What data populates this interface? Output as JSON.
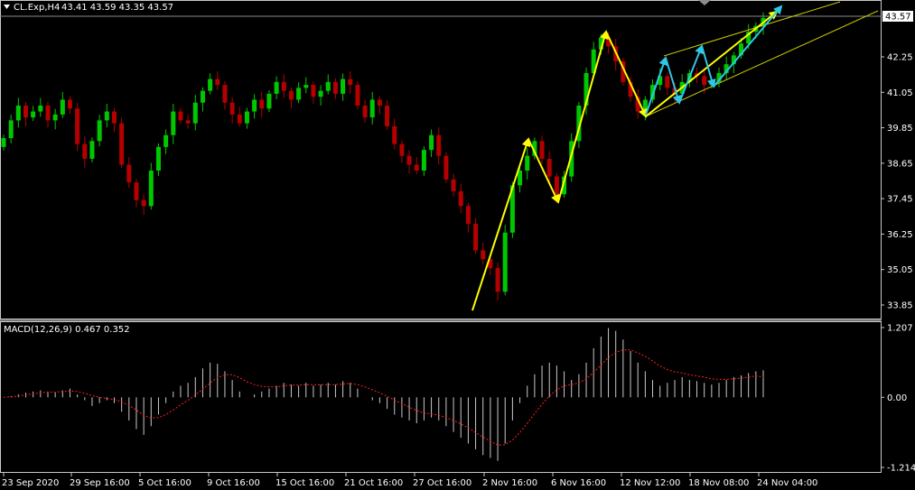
{
  "header": {
    "symbol_label": "CL.Exp,H4",
    "ohlc_label": "43.41 43.59 43.35 43.57"
  },
  "macd": {
    "label": "MACD(12,26,9) 0.467 0.352"
  },
  "colors": {
    "background": "#000000",
    "bull_candle": "#00c800",
    "bear_candle": "#b40000",
    "frame": "#c8c8c8",
    "bid_line": "#8c8c8c",
    "price_tag_bg": "#ffffff",
    "wave_yellow": "#ffff00",
    "wave_cyan": "#2ec8e6",
    "channel": "#c8c800",
    "macd_hist": "#c8c8c8",
    "macd_signal": "#ff2020"
  },
  "chart_data": [
    {
      "type": "candlestick",
      "title": "CL.Exp,H4",
      "current_price": "43.57",
      "y_ticks": [
        "42.25",
        "41.05",
        "39.85",
        "38.65",
        "37.45",
        "36.25",
        "35.05",
        "33.85"
      ],
      "ylim": [
        33.5,
        43.8
      ],
      "x_ticks": [
        "23 Sep 2020",
        "29 Sep 16:00",
        "5 Oct 16:00",
        "9 Oct 16:00",
        "15 Oct 16:00",
        "21 Oct 16:00",
        "27 Oct 16:00",
        "2 Nov 16:00",
        "6 Nov 16:00",
        "12 Nov 12:00",
        "18 Nov 08:00",
        "24 Nov 04:00"
      ],
      "closes": [
        39.5,
        40.1,
        40.6,
        40.2,
        40.4,
        40.6,
        40.1,
        40.3,
        40.8,
        40.5,
        39.3,
        38.8,
        39.4,
        40.1,
        40.4,
        40.0,
        38.6,
        38.0,
        37.4,
        37.2,
        38.4,
        39.2,
        39.6,
        40.4,
        40.1,
        40.0,
        40.7,
        41.1,
        41.5,
        41.3,
        40.7,
        40.3,
        40.0,
        40.4,
        40.8,
        40.5,
        41.0,
        41.4,
        41.1,
        40.8,
        41.2,
        41.3,
        40.9,
        41.1,
        41.4,
        41.0,
        41.5,
        41.3,
        40.6,
        40.2,
        40.8,
        40.6,
        39.9,
        39.3,
        38.9,
        38.6,
        38.4,
        39.1,
        39.6,
        38.9,
        38.1,
        37.7,
        37.2,
        36.6,
        35.7,
        35.4,
        35.1,
        34.3,
        36.3,
        37.9,
        38.4,
        38.9,
        39.4,
        38.8,
        38.2,
        37.6,
        38.2,
        39.4,
        40.6,
        41.7,
        42.5,
        42.9,
        42.6,
        42.1,
        41.4,
        40.9,
        40.4,
        40.8,
        41.3,
        41.6,
        41.2,
        41.0,
        41.4,
        41.7,
        41.6,
        41.3,
        41.4,
        41.7,
        42.0,
        42.3,
        42.7,
        43.1,
        43.3,
        43.57
      ],
      "annotations": "Elliott wave arrows (yellow, cyan) and a rising trend channel"
    },
    {
      "type": "bar",
      "title": "MACD(12,26,9)",
      "main_value": 0.467,
      "signal_value": 0.352,
      "y_ticks": [
        "1.207",
        "0.00",
        "-1.214"
      ],
      "ylim": [
        -1.214,
        1.207
      ],
      "histogram": [
        0.0,
        0.02,
        0.05,
        0.08,
        0.1,
        0.12,
        0.1,
        0.08,
        0.12,
        0.15,
        0.05,
        -0.05,
        -0.15,
        -0.1,
        -0.05,
        -0.1,
        -0.25,
        -0.4,
        -0.55,
        -0.65,
        -0.5,
        -0.3,
        -0.1,
        0.1,
        0.2,
        0.25,
        0.35,
        0.5,
        0.6,
        0.58,
        0.45,
        0.3,
        0.1,
        0.0,
        0.05,
        0.1,
        0.15,
        0.2,
        0.25,
        0.22,
        0.2,
        0.25,
        0.2,
        0.22,
        0.25,
        0.22,
        0.28,
        0.25,
        0.15,
        0.0,
        -0.05,
        -0.1,
        -0.2,
        -0.3,
        -0.35,
        -0.4,
        -0.45,
        -0.4,
        -0.35,
        -0.4,
        -0.5,
        -0.6,
        -0.7,
        -0.8,
        -0.9,
        -1.0,
        -1.05,
        -1.1,
        -0.8,
        -0.4,
        -0.1,
        0.2,
        0.4,
        0.55,
        0.6,
        0.55,
        0.45,
        0.3,
        0.4,
        0.6,
        0.85,
        1.05,
        1.2,
        1.15,
        1.0,
        0.8,
        0.6,
        0.45,
        0.3,
        0.2,
        0.25,
        0.3,
        0.35,
        0.3,
        0.28,
        0.25,
        0.22,
        0.25,
        0.3,
        0.35,
        0.38,
        0.42,
        0.45,
        0.467
      ],
      "signal": [
        0.0,
        0.01,
        0.02,
        0.04,
        0.06,
        0.08,
        0.09,
        0.09,
        0.1,
        0.11,
        0.1,
        0.07,
        0.03,
        0.0,
        -0.02,
        -0.04,
        -0.08,
        -0.14,
        -0.22,
        -0.31,
        -0.36,
        -0.35,
        -0.3,
        -0.22,
        -0.13,
        -0.05,
        0.04,
        0.14,
        0.25,
        0.34,
        0.39,
        0.39,
        0.34,
        0.27,
        0.22,
        0.19,
        0.18,
        0.18,
        0.2,
        0.21,
        0.21,
        0.22,
        0.22,
        0.22,
        0.22,
        0.22,
        0.23,
        0.24,
        0.22,
        0.18,
        0.13,
        0.08,
        0.02,
        -0.05,
        -0.11,
        -0.17,
        -0.23,
        -0.27,
        -0.29,
        -0.31,
        -0.35,
        -0.4,
        -0.46,
        -0.53,
        -0.61,
        -0.69,
        -0.76,
        -0.83,
        -0.82,
        -0.74,
        -0.61,
        -0.45,
        -0.28,
        -0.12,
        0.02,
        0.13,
        0.2,
        0.22,
        0.25,
        0.32,
        0.43,
        0.56,
        0.69,
        0.78,
        0.82,
        0.82,
        0.77,
        0.71,
        0.63,
        0.54,
        0.48,
        0.44,
        0.42,
        0.39,
        0.37,
        0.35,
        0.32,
        0.31,
        0.31,
        0.32,
        0.33,
        0.35,
        0.37,
        0.352
      ]
    }
  ]
}
